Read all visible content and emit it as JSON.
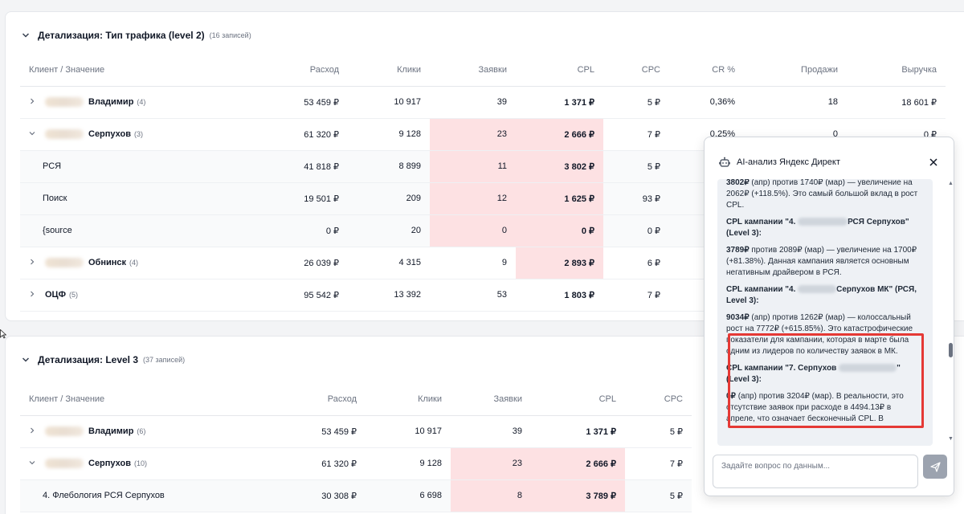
{
  "level2": {
    "title": "Детализация: Тип трафика (level 2)",
    "count": "(16 записей)",
    "columns": [
      "Клиент / Значение",
      "Расход",
      "Клики",
      "Заявки",
      "CPL",
      "CPC",
      "CR %",
      "Продажи",
      "Выручка"
    ],
    "rows": [
      {
        "name": "Владимир",
        "count": "(4)",
        "values": [
          "53 459 ₽",
          "10 917",
          "39",
          "1 371 ₽",
          "5 ₽",
          "0,36%",
          "18",
          "18 601 ₽"
        ]
      },
      {
        "name": "Серпухов",
        "count": "(3)",
        "values": [
          "61 320 ₽",
          "9 128",
          "23",
          "2 666 ₽",
          "7 ₽",
          "0,25%",
          "0",
          "0 ₽"
        ]
      },
      {
        "name": "РСЯ",
        "values": [
          "41 818 ₽",
          "8 899",
          "11",
          "3 802 ₽",
          "5 ₽"
        ]
      },
      {
        "name": "Поиск",
        "values": [
          "19 501 ₽",
          "209",
          "12",
          "1 625 ₽",
          "93 ₽"
        ]
      },
      {
        "name": "{source",
        "values": [
          "0 ₽",
          "20",
          "0",
          "0 ₽",
          "0 ₽"
        ]
      },
      {
        "name": "Обнинск",
        "count": "(4)",
        "values": [
          "26 039 ₽",
          "4 315",
          "9",
          "2 893 ₽",
          "6 ₽"
        ]
      },
      {
        "name": "ОЦФ",
        "count": "(5)",
        "values": [
          "95 542 ₽",
          "13 392",
          "53",
          "1 803 ₽",
          "7 ₽"
        ]
      }
    ]
  },
  "level3": {
    "title": "Детализация: Level 3",
    "count": "(37 записей)",
    "columns": [
      "Клиент / Значение",
      "Расход",
      "Клики",
      "Заявки",
      "CPL",
      "CPC"
    ],
    "rows": [
      {
        "name": "Владимир",
        "count": "(6)",
        "values": [
          "53 459 ₽",
          "10 917",
          "39",
          "1 371 ₽",
          "5 ₽"
        ]
      },
      {
        "name": "Серпухов",
        "count": "(10)",
        "values": [
          "61 320 ₽",
          "9 128",
          "23",
          "2 666 ₽",
          "7 ₽"
        ]
      },
      {
        "name": "4. Флебология РСЯ Серпухов",
        "values": [
          "30 308 ₽",
          "6 698",
          "8",
          "3 789 ₽",
          "5 ₽"
        ]
      }
    ]
  },
  "ai_panel": {
    "title": "AI-анализ Яндекс Директ",
    "messages": {
      "m1_val": "3802₽",
      "m1_text": " (апр) против 1740₽ (мар) — увеличение на 2062₽ (+118.5%). Это самый большой вклад в рост CPL.",
      "m2_head_a": "CPL кампании \"4. ",
      "m2_head_b": "РСЯ Серпухов\" (Level 3):",
      "m2_val": "3789₽",
      "m2_text": " против 2089₽ (мар) — увеличение на 1700₽ (+81.38%). Данная кампания является основным негативным драйвером в РСЯ.",
      "m3_head_a": "CPL кампании \"4. ",
      "m3_head_b": "Серпухов МК\" (РСЯ, Level 3):",
      "m3_val": "9034₽",
      "m3_text": " (апр) против 1262₽ (мар) — колоссальный рост на 7772₽ (+615.85%). Это катастрофические показатели для кампании, которая в марте была одним из лидеров по количеству заявок в МК.",
      "m4_head_a": "CPL кампании \"7. Серпухов",
      "m4_head_b": "\" (Level 3):",
      "m4_val": "0₽",
      "m4_text": " (апр) против 3204₽ (мар). В реальности, это отсутствие заявок при расходе в 4494.13₽ в апреле, что означает бесконечный CPL. В"
    },
    "input_placeholder": "Задайте вопрос по данным..."
  },
  "colors": {
    "highlight_cell": "#fde1e3",
    "annotation_box": "#e53935",
    "send_button": "#9ca3af"
  }
}
